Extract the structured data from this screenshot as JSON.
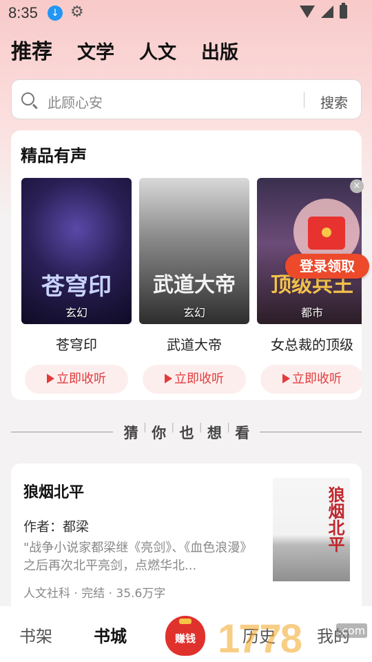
{
  "status_bar": {
    "time": "8:35",
    "download_icon": "download-badge-icon",
    "settings_icon": "gear-icon"
  },
  "top_tabs": [
    {
      "label": "推荐",
      "active": true
    },
    {
      "label": "文学",
      "active": false
    },
    {
      "label": "人文",
      "active": false
    },
    {
      "label": "出版",
      "active": false
    }
  ],
  "search": {
    "placeholder": "此顾心安",
    "button": "搜索"
  },
  "premium_audio": {
    "title": "精品有声",
    "books": [
      {
        "title": "苍穹印",
        "genre": "玄幻",
        "cover_text": "苍穹印",
        "listen": "立即收听"
      },
      {
        "title": "武道大帝",
        "genre": "玄幻",
        "cover_text": "武道大帝",
        "listen": "立即收听"
      },
      {
        "title": "女总裁的顶级",
        "genre": "都市",
        "cover_text": "顶级兵王",
        "listen": "立即收听"
      }
    ]
  },
  "reward": {
    "label": "登录领取",
    "close": "×"
  },
  "guess": {
    "chars": [
      "猜",
      "你",
      "也",
      "想",
      "看"
    ]
  },
  "recommendation": {
    "title": "狼烟北平",
    "author": "作者：都梁",
    "description": "\"战争小说家都梁继《亮剑》、《血色浪漫》之后再次北平亮剑，点燃华北...",
    "meta": "人文社科 · 完结 · 35.6万字",
    "cover_title": "狼烟北平"
  },
  "bottom_nav": {
    "shelf": "书架",
    "store": "书城",
    "earn": "赚钱",
    "history": "历史",
    "mine": "我的"
  },
  "watermark": {
    "text": "1778",
    "site": ".com"
  },
  "colors": {
    "accent": "#e23b3b",
    "reward": "#ec4a2b"
  }
}
